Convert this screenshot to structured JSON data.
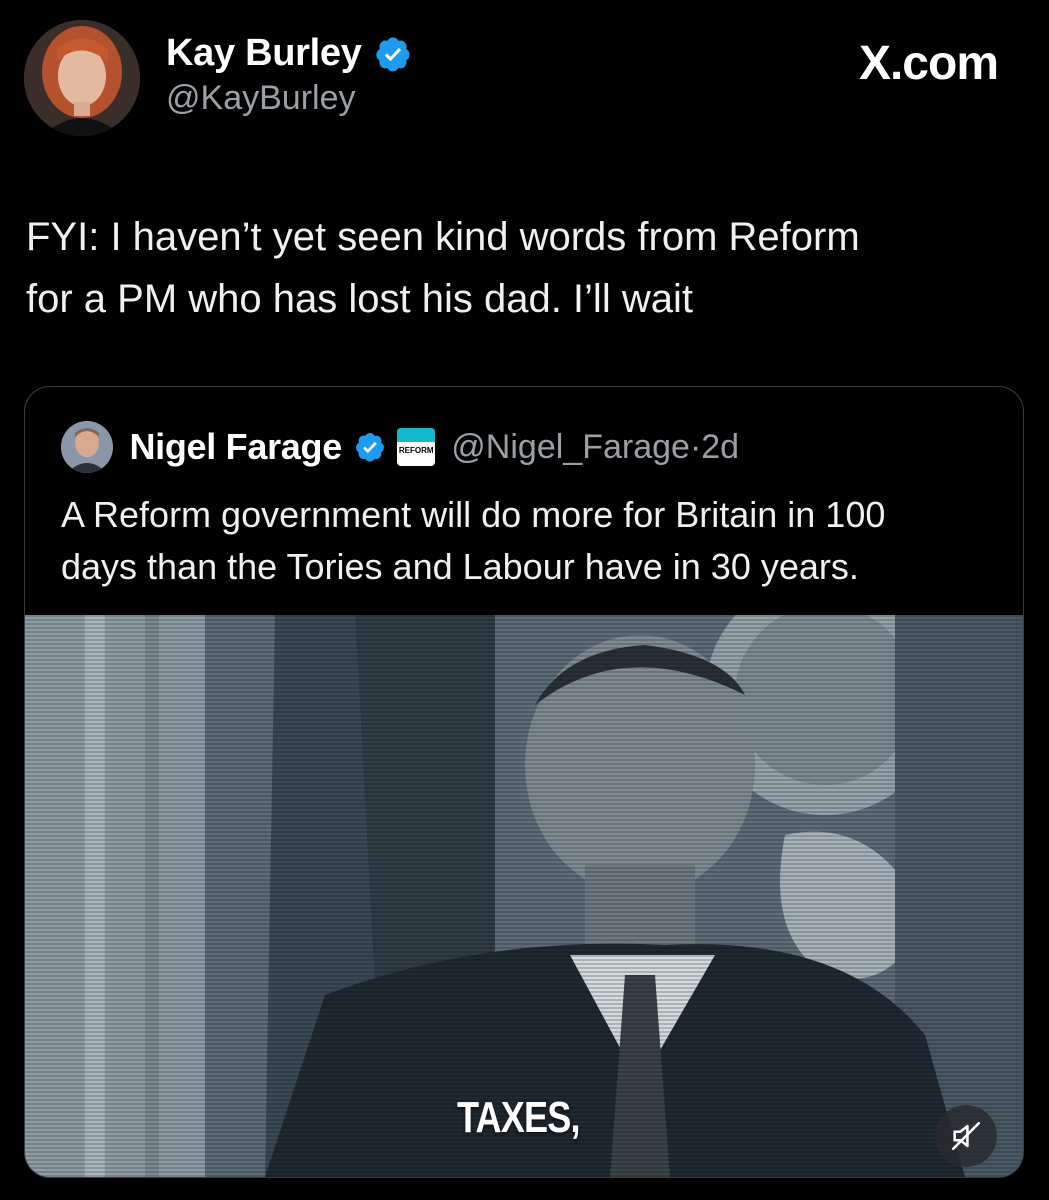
{
  "tweet": {
    "author_name": "Kay Burley",
    "author_handle": "@KayBurley",
    "brand": "X.com",
    "text_lines": [
      "FYI: I haven’t yet seen kind words from Reform",
      "for a PM who has lost his dad.  I’ll wait"
    ],
    "verified_color": "#1d9bf0"
  },
  "quoted_tweet": {
    "author_name": "Nigel Farage",
    "author_handle": "@Nigel_Farage",
    "separator": "·",
    "time": "2d",
    "badge_text": "REFORM",
    "text_lines": [
      "A Reform government will do more for Britain in 100",
      "days than the Tories and Labour have in 30 years."
    ],
    "media": {
      "caption": "TAXES,",
      "mute_icon": "speaker-muted-icon"
    }
  }
}
